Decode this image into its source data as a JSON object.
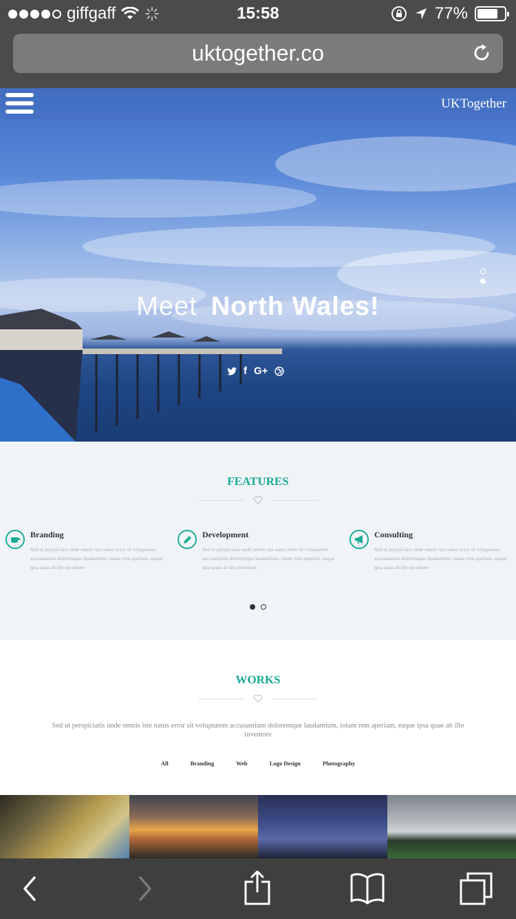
{
  "status_bar": {
    "carrier": "giffgaff",
    "time": "15:58",
    "battery": "77%",
    "battery_level": 0.77,
    "icons": [
      "signal-dots-icon",
      "wifi-icon",
      "loading-spinner-icon",
      "orientation-lock-icon",
      "location-arrow-icon",
      "battery-icon"
    ]
  },
  "browser": {
    "url": "uktogether.co",
    "reload_icon": "reload-icon"
  },
  "site": {
    "menu_icon": "hamburger-menu-icon",
    "brand": "UKTogether"
  },
  "hero": {
    "title_light": "Meet",
    "title_bold": "North  Wales!",
    "social_icons": [
      "twitter-icon",
      "facebook-icon",
      "google-plus-icon",
      "dribbble-icon"
    ],
    "social_labels": {
      "facebook": "f",
      "google": "G+"
    },
    "slide_count": 2,
    "active_slide": 2
  },
  "features": {
    "title": "FEATURES",
    "items": [
      {
        "title": "Branding",
        "icon": "coffee-cup-icon",
        "desc": "Sed ut perspiciatis unde omnis iste natus error sit voluptatem accusantium doloremque laudantium, totam rem aperiam, eaque ipsa quae ab illo inventore"
      },
      {
        "title": "Development",
        "icon": "pencil-icon",
        "desc": "Sed ut perspiciatis unde omnis iste natus error sit voluptatem accusantium doloremque laudantium, totam rem aperiam, eaque ipsa quae ab illo inventore"
      },
      {
        "title": "Consulting",
        "icon": "megaphone-icon",
        "desc": "Sed ut perspiciatis unde omnis iste natus error sit voluptatem accusantium doloremque laudantium, totam rem aperiam, eaque ipsa quae ab illo inventore"
      }
    ],
    "page_count": 2,
    "active_page": 1
  },
  "works": {
    "title": "WORKS",
    "description": "Sed ut perspiciatis unde omnis iste natus error sit voluptatem accusantium doloremque laudantium, totam rem aperiam, eaque ipsa quae ab illo inventore",
    "filters": [
      "All",
      "Branding",
      "Web",
      "Logo Design",
      "Photography"
    ]
  },
  "colors": {
    "accent": "#1bab96",
    "browser_chrome": "#4b4b4b",
    "features_bg": "#f1f4f7"
  },
  "toolbar": {
    "icons": [
      "back-arrow-icon",
      "forward-arrow-icon",
      "share-icon",
      "bookmarks-icon",
      "tabs-icon"
    ]
  }
}
